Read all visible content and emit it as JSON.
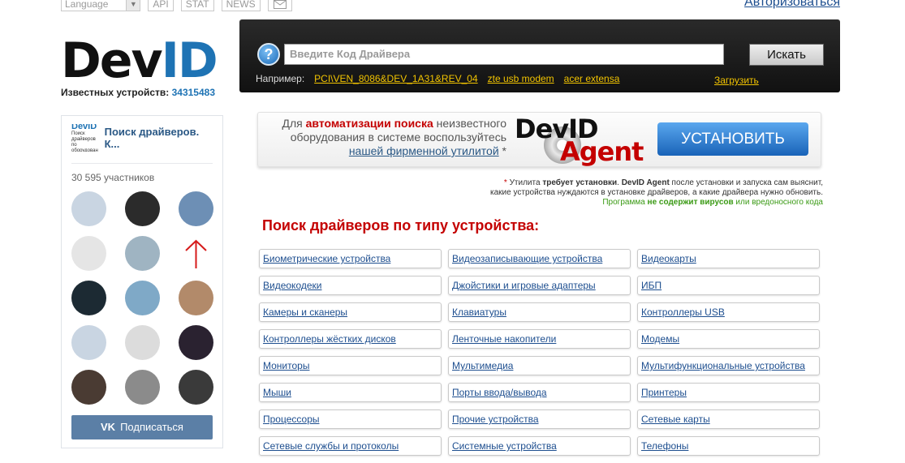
{
  "topbar": {
    "language": "Language",
    "api": "API",
    "stat": "STAT",
    "news": "NEWS",
    "login": "Авторизоваться"
  },
  "logo": {
    "dev": "Dev",
    "id": "ID"
  },
  "known": {
    "label": "Известных устройств:",
    "count": "34315483"
  },
  "search": {
    "placeholder": "Введите Код Драйвера",
    "button": "Искать",
    "examples_label": "Например:",
    "examples": [
      "PCI\\VEN_8086&DEV_1A31&REV_04",
      "zte usb modem",
      "acer extensa"
    ],
    "upload": "Загрузить"
  },
  "vk": {
    "logo_name": "DevID",
    "logo_text": "Поиск драйверов по оборудованию версия к",
    "title": "Поиск драйверов. К...",
    "members": "30 595 участников",
    "subscribe": "Подписаться"
  },
  "banner": {
    "text1": "Для ",
    "text_red": "автоматизации поиска",
    "text2": " неизвестного оборудования в системе воспользуйтесь ",
    "link": "нашей фирменной утилитой",
    "star": " *",
    "agent1": "DevID",
    "agent2": "Agent",
    "install": "УСТАНОВИТЬ"
  },
  "note": {
    "line1_star": "*",
    "line1_a": " Утилита ",
    "line1_b": "требует установки",
    "line1_c": ". ",
    "line1_d": "DevID Agent",
    "line1_e": " после установки и запуска сам выяснит,",
    "line2": "какие устройства нуждаются в установке драйверов, а какие драйвера нужно обновить.",
    "line3_a": "Программа ",
    "line3_b": "не содержит вирусов",
    "line3_c": " или вредоносного кода"
  },
  "categories_title": "Поиск драйверов по типу устройства:",
  "categories": [
    "Биометрические устройства",
    "Видеозаписывающие устройства",
    "Видеокарты",
    "Видеокодеки",
    "Джойстики и игровые адаптеры",
    "ИБП",
    "Камеры и сканеры",
    "Клавиатуры",
    "Контроллеры USB",
    "Контроллеры жёстких дисков",
    "Ленточные накопители",
    "Модемы",
    "Мониторы",
    "Мультимедиа",
    "Мультифункциональные устройства",
    "Мыши",
    "Порты ввода/вывода",
    "Принтеры",
    "Процессоры",
    "Прочие устройства",
    "Сетевые карты",
    "Сетевые службы и протоколы",
    "Системные устройства",
    "Телефоны"
  ],
  "avatar_colors": [
    "#c9d5e2",
    "#2b2b2b",
    "#6d8fb5",
    "#e5e5e5",
    "#9fb4c2",
    "#ffffff",
    "#1c2a33",
    "#7fa9c7",
    "#b28a6a",
    "#c9d5e2",
    "#dcdcdc",
    "#2a2230",
    "#4a3b33",
    "#8b8b8b",
    "#3a3a3a"
  ]
}
